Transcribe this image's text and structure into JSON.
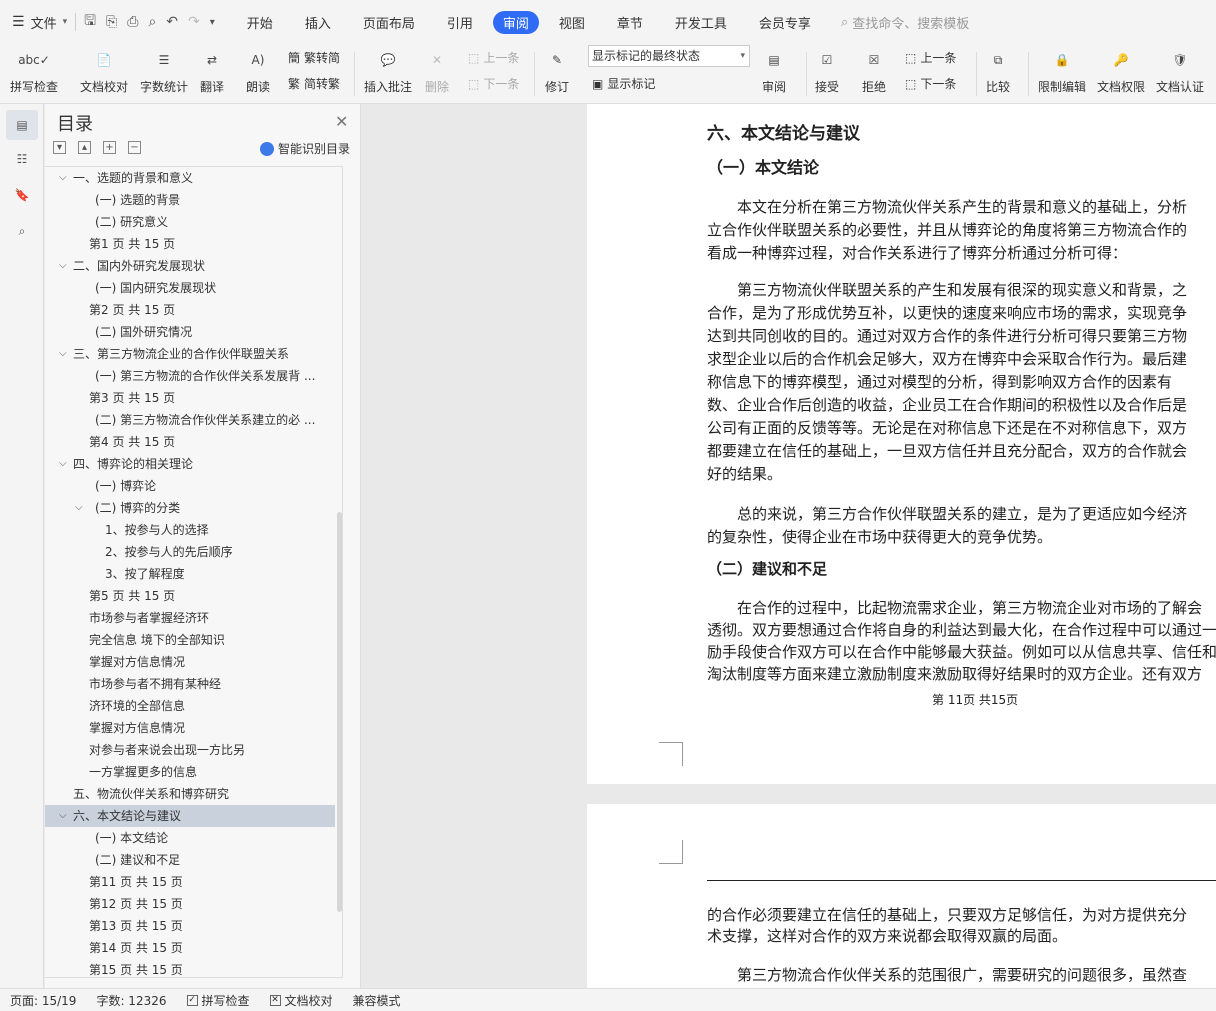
{
  "menubar": {
    "file_label": "文件",
    "tabs": [
      "开始",
      "插入",
      "页面布局",
      "引用",
      "审阅",
      "视图",
      "章节",
      "开发工具",
      "会员专享"
    ],
    "active_tab": "审阅",
    "search_placeholder": "查找命令、搜索模板"
  },
  "ribbon": {
    "spellcheck": "拼写检查",
    "doc_proof": "文档校对",
    "word_count": "字数统计",
    "translate": "翻译",
    "read_aloud": "朗读",
    "trad_to_simp": "繁转简",
    "simp_to_trad": "简转繁",
    "insert_comment": "插入批注",
    "delete": "删除",
    "prev_comment": "上一条",
    "next_comment": "下一条",
    "revise": "修订",
    "markup_mode": "显示标记的最终状态",
    "show_markup": "显示标记",
    "review": "审阅",
    "accept": "接受",
    "reject": "拒绝",
    "prev_change": "上一条",
    "next_change": "下一条",
    "compare": "比较",
    "restrict_edit": "限制编辑",
    "doc_permission": "文档权限",
    "doc_cert": "文档认证"
  },
  "toc": {
    "title": "目录",
    "smart_label": "智能识别目录",
    "items": [
      {
        "label": "一、选题的背景和意义",
        "indent": 1,
        "chevron": "down"
      },
      {
        "label": "(一)  选题的背景",
        "indent": 2
      },
      {
        "label": "(二)  研究意义",
        "indent": 2
      },
      {
        "label": "第1 页 共 15 页",
        "indent": 3
      },
      {
        "label": "二、国内外研究发展现状",
        "indent": 1,
        "chevron": "down"
      },
      {
        "label": "(一) 国内研究发展现状",
        "indent": 2
      },
      {
        "label": "第2 页 共 15 页",
        "indent": 3
      },
      {
        "label": "(二) 国外研究情况",
        "indent": 2
      },
      {
        "label": "三、第三方物流企业的合作伙伴联盟关系",
        "indent": 1,
        "chevron": "down"
      },
      {
        "label": "(一) 第三方物流的合作伙伴关系发展背 ...",
        "indent": 2
      },
      {
        "label": "第3 页 共 15 页",
        "indent": 3
      },
      {
        "label": "(二) 第三方物流合作伙伴关系建立的必 ...",
        "indent": 2
      },
      {
        "label": "第4 页 共 15 页",
        "indent": 3
      },
      {
        "label": "四、博弈论的相关理论",
        "indent": 1,
        "chevron": "down"
      },
      {
        "label": "(一) 博弈论",
        "indent": 2
      },
      {
        "label": "(二) 博弈的分类",
        "indent": 2,
        "chevron": "down"
      },
      {
        "label": "1、按参与人的选择",
        "indent": 4
      },
      {
        "label": "2、按参与人的先后顺序",
        "indent": 4
      },
      {
        "label": "3、按了解程度",
        "indent": 4
      },
      {
        "label": "第5 页 共 15 页",
        "indent": 3
      },
      {
        "label": "市场参与者掌握经济环",
        "indent": 3
      },
      {
        "label": "完全信息 境下的全部知识",
        "indent": 3
      },
      {
        "label": "掌握对方信息情况",
        "indent": 3
      },
      {
        "label": "市场参与者不拥有某种经",
        "indent": 3
      },
      {
        "label": "济环境的全部信息",
        "indent": 3
      },
      {
        "label": "掌握对方信息情况",
        "indent": 3
      },
      {
        "label": "对参与者来说会出现一方比另",
        "indent": 3
      },
      {
        "label": "一方掌握更多的信息",
        "indent": 3
      },
      {
        "label": "五、物流伙伴关系和博弈研究",
        "indent": 1
      },
      {
        "label": "六、本文结论与建议",
        "indent": 1,
        "chevron": "down",
        "selected": true
      },
      {
        "label": "(一) 本文结论",
        "indent": 2
      },
      {
        "label": "(二) 建议和不足",
        "indent": 2
      },
      {
        "label": "第11 页 共 15 页",
        "indent": 3
      },
      {
        "label": "第12 页 共 15 页",
        "indent": 3
      },
      {
        "label": "第13 页 共 15 页",
        "indent": 3
      },
      {
        "label": "第14 页 共 15 页",
        "indent": 3
      },
      {
        "label": "第15 页 共 15 页",
        "indent": 3
      }
    ]
  },
  "document": {
    "h1": "六、本文结论与建议",
    "h2": "（一）本文结论",
    "para1": [
      "本文在分析在第三方物流伙伴关系产生的背景和意义的基础上，分析",
      "立合作伙伴联盟关系的必要性，并且从博弈论的角度将第三方物流合作的",
      "看成一种博弈过程，对合作关系进行了博弈分析通过分析可得："
    ],
    "para2": [
      "第三方物流伙伴联盟关系的产生和发展有很深的现实意义和背景，之",
      "合作，是为了形成优势互补，以更快的速度来响应市场的需求，实现竞争",
      "达到共同创收的目的。通过对双方合作的条件进行分析可得只要第三方物",
      "求型企业以后的合作机会足够大，双方在博弈中会采取合作行为。最后建",
      "称信息下的博弈模型，通过对模型的分析，得到影响双方合作的因素有",
      "数、企业合作后创造的收益，企业员工在合作期间的积极性以及合作后是",
      "公司有正面的反馈等等。无论是在对称信息下还是在不对称信息下，双方",
      "都要建立在信任的基础上，一旦双方信任并且充分配合，双方的合作就会",
      "好的结果。"
    ],
    "para3": [
      "总的来说，第三方合作伙伴联盟关系的建立，是为了更适应如今经济",
      "的复杂性，使得企业在市场中获得更大的竞争优势。"
    ],
    "h3": "（二）建议和不足",
    "para4": [
      "在合作的过程中，比起物流需求企业，第三方物流企业对市场的了解会",
      "透彻。双方要想通过合作将自身的利益达到最大化，在合作过程中可以通过一",
      "励手段使合作双方可以在合作中能够最大获益。例如可以从信息共享、信任和",
      "淘汰制度等方面来建立激励制度来激励取得好结果时的双方企业。还有双方"
    ],
    "footer": "第 11页 共15页",
    "page2_para1": [
      "的合作必须要建立在信任的基础上，只要双方足够信任，为对方提供充分",
      "术支撑，这样对合作的双方来说都会取得双赢的局面。"
    ],
    "page2_para2": "第三方物流合作伙伴关系的范围很广，需要研究的问题很多，虽然查"
  },
  "statusbar": {
    "page": "页面: 15/19",
    "words": "字数: 12326",
    "spellcheck": "拼写检查",
    "doc_proof": "文档校对",
    "compat": "兼容模式"
  }
}
